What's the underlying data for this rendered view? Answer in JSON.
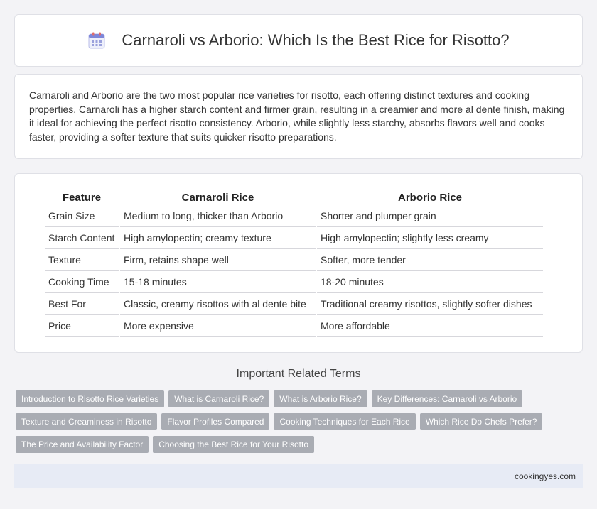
{
  "header": {
    "icon": "calendar-icon",
    "title": "Carnaroli vs Arborio: Which Is the Best Rice for Risotto?"
  },
  "intro": {
    "text": "Carnaroli and Arborio are the two most popular rice varieties for risotto, each offering distinct textures and cooking properties. Carnaroli has a higher starch content and firmer grain, resulting in a creamier and more al dente finish, making it ideal for achieving the perfect risotto consistency. Arborio, while slightly less starchy, absorbs flavors well and cooks faster, providing a softer texture that suits quicker risotto preparations."
  },
  "table": {
    "headers": [
      "Feature",
      "Carnaroli Rice",
      "Arborio Rice"
    ],
    "rows": [
      [
        "Grain Size",
        "Medium to long, thicker than Arborio",
        "Shorter and plumper grain"
      ],
      [
        "Starch Content",
        "High amylopectin; creamy texture",
        "High amylopectin; slightly less creamy"
      ],
      [
        "Texture",
        "Firm, retains shape well",
        "Softer, more tender"
      ],
      [
        "Cooking Time",
        "15-18 minutes",
        "18-20 minutes"
      ],
      [
        "Best For",
        "Classic, creamy risottos with al dente bite",
        "Traditional creamy risottos, slightly softer dishes"
      ],
      [
        "Price",
        "More expensive",
        "More affordable"
      ]
    ]
  },
  "related": {
    "title": "Important Related Terms",
    "rows": [
      [
        "Introduction to Risotto Rice Varieties",
        "What is Carnaroli Rice?",
        "What is Arborio Rice?",
        "Key Differences: Carnaroli vs Arborio"
      ],
      [
        "Texture and Creaminess in Risotto",
        "Flavor Profiles Compared",
        "Cooking Techniques for Each Rice",
        "Which Rice Do Chefs Prefer?"
      ],
      [
        "The Price and Availability Factor",
        "Choosing the Best Rice for Your Risotto"
      ]
    ]
  },
  "footer": {
    "site": "cookingyes.com"
  },
  "colors": {
    "tag_bg": "#a9acb3",
    "footer_bg": "#e7ebf5",
    "page_bg": "#f3f3f6"
  }
}
